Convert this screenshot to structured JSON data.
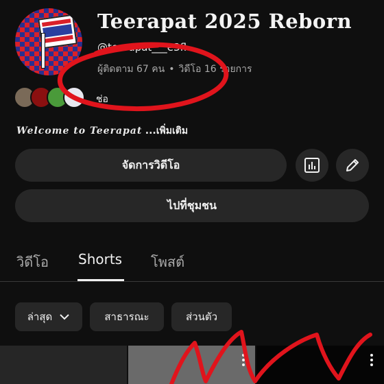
{
  "channel": {
    "name": "Teerapat 2025 Reborn",
    "handle": "@teerapat___e3fl",
    "subscribers": "ผู้ติดตาม 67 คน",
    "separator": "•",
    "videos": "วิดีโอ 16 รายการ",
    "associated_label": "ช่อ",
    "description_sig": "Welcome to Teerapat",
    "description_more": "...เพิ่มเติม"
  },
  "buttons": {
    "manage_videos": "จัดการวิดีโอ",
    "go_to_community": "ไปที่ชุมชน",
    "analytics_icon": "bar-chart-icon",
    "edit_icon": "pencil-icon"
  },
  "tabs": [
    {
      "label": "วิดีโอ",
      "active": false
    },
    {
      "label": "Shorts",
      "active": true
    },
    {
      "label": "โพสต์",
      "active": false
    }
  ],
  "filters": {
    "sort_selected": "ล่าสุด",
    "public": "สาธารณะ",
    "private": "ส่วนตัว"
  },
  "colors": {
    "background": "#0f0f0f",
    "surface": "#272727",
    "scribble": "#e0141c"
  }
}
